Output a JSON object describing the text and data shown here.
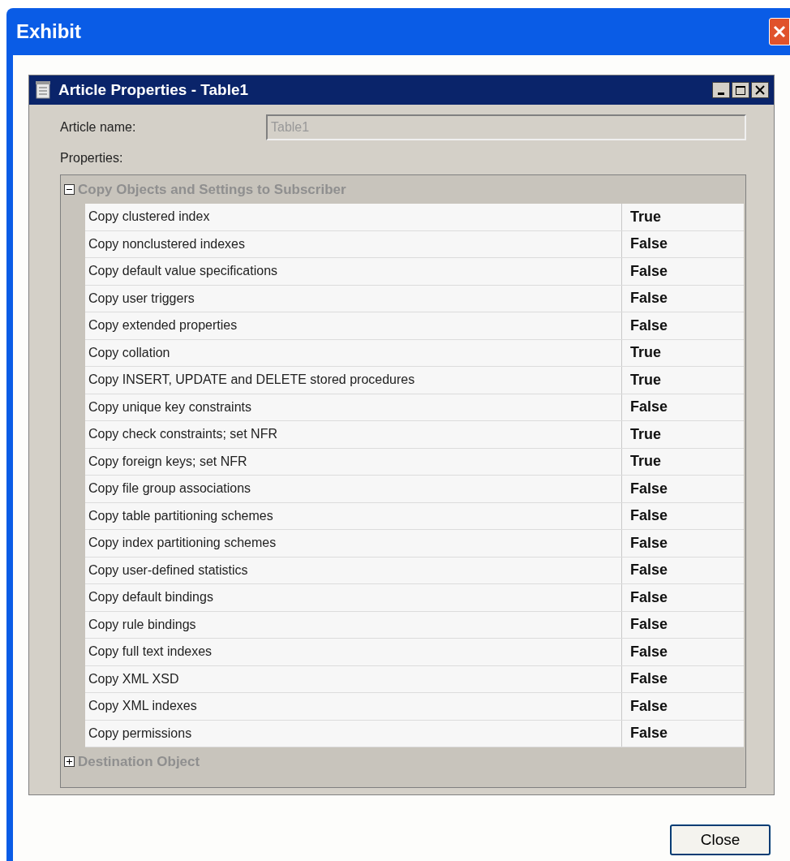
{
  "window": {
    "title": "Exhibit"
  },
  "dialog": {
    "title": "Article Properties - Table1",
    "article_name": {
      "label": "Article name:",
      "value": "Table1",
      "disabled": true
    },
    "properties_label": "Properties:",
    "groups": [
      {
        "title": "Copy Objects and Settings to Subscriber",
        "expanded": true,
        "properties": [
          {
            "name": "Copy clustered index",
            "value": "True"
          },
          {
            "name": "Copy nonclustered indexes",
            "value": "False"
          },
          {
            "name": "Copy default value specifications",
            "value": "False"
          },
          {
            "name": "Copy user triggers",
            "value": "False"
          },
          {
            "name": "Copy extended properties",
            "value": "False"
          },
          {
            "name": "Copy collation",
            "value": "True"
          },
          {
            "name": "Copy INSERT, UPDATE and DELETE stored procedures",
            "value": "True"
          },
          {
            "name": "Copy unique key constraints",
            "value": "False"
          },
          {
            "name": "Copy check constraints; set NFR",
            "value": "True"
          },
          {
            "name": "Copy foreign keys; set NFR",
            "value": "True"
          },
          {
            "name": "Copy file group associations",
            "value": "False"
          },
          {
            "name": "Copy table partitioning schemes",
            "value": "False"
          },
          {
            "name": "Copy index partitioning schemes",
            "value": "False"
          },
          {
            "name": "Copy user-defined statistics",
            "value": "False"
          },
          {
            "name": "Copy default bindings",
            "value": "False"
          },
          {
            "name": "Copy rule bindings",
            "value": "False"
          },
          {
            "name": "Copy full text indexes",
            "value": "False"
          },
          {
            "name": "Copy XML XSD",
            "value": "False"
          },
          {
            "name": "Copy XML indexes",
            "value": "False"
          },
          {
            "name": "Copy permissions",
            "value": "False"
          }
        ]
      },
      {
        "title": "Destination Object",
        "expanded": false
      }
    ]
  },
  "buttons": [
    {
      "label": "Close"
    }
  ]
}
